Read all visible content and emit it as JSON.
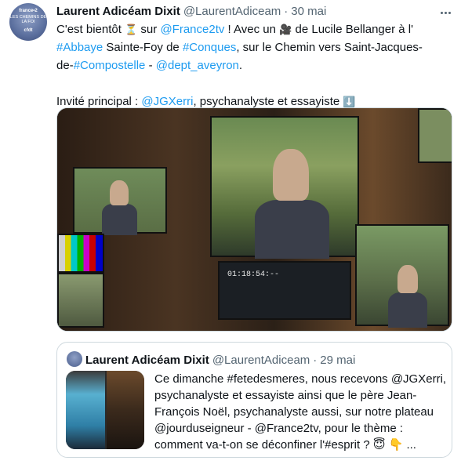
{
  "author": {
    "avatar_lines": [
      "france•2",
      "LES CHEMINS DE LA FOI",
      "cfdt"
    ],
    "display_name": "Laurent Adicéam Dixit",
    "handle": "@LaurentAdiceam",
    "separator": "·",
    "date": "30 mai"
  },
  "tweet": {
    "line1": [
      {
        "t": "C'est bientôt ",
        "k": "text"
      },
      {
        "t": "⏳",
        "k": "emoji"
      },
      {
        "t": " sur ",
        "k": "text"
      },
      {
        "t": "@France2tv",
        "k": "link"
      },
      {
        "t": " ! Avec un ",
        "k": "text"
      },
      {
        "t": "🎥",
        "k": "emoji"
      },
      {
        "t": " de Lucile Bellanger à l'",
        "k": "text"
      }
    ],
    "line2": [
      {
        "t": "#Abbaye",
        "k": "link"
      },
      {
        "t": " Sainte-Foy de ",
        "k": "text"
      },
      {
        "t": "#Conques",
        "k": "link"
      },
      {
        "t": ", sur le Chemin vers Saint-Jacques-",
        "k": "text"
      }
    ],
    "line3": [
      {
        "t": "de-",
        "k": "text"
      },
      {
        "t": "#Compostelle",
        "k": "link"
      },
      {
        "t": " - ",
        "k": "text"
      },
      {
        "t": "@dept_aveyron",
        "k": "link"
      },
      {
        "t": ".",
        "k": "text"
      }
    ],
    "line5": [
      {
        "t": "Invité principal : ",
        "k": "text"
      },
      {
        "t": "@JGXerri",
        "k": "link"
      },
      {
        "t": ", psychanalyste et essayiste ",
        "k": "text"
      },
      {
        "t": "⬇️",
        "k": "emoji"
      }
    ]
  },
  "media": {
    "timecode": "01:18:54:--"
  },
  "quoted": {
    "display_name": "Laurent Adicéam Dixit",
    "handle": "@LaurentAdiceam",
    "separator": "·",
    "date": "29 mai",
    "lines": [
      "Ce dimanche #fetedesmeres, nous recevons @JGXerri,",
      "psychanalyste et essayiste ainsi que le père Jean-",
      "François Noël, psychanalyste aussi, sur notre plateau",
      "@jourduseigneur - @France2tv, pour le thème :",
      "comment va-t-on se déconfiner l'#esprit ? 😇 👇   ..."
    ]
  }
}
